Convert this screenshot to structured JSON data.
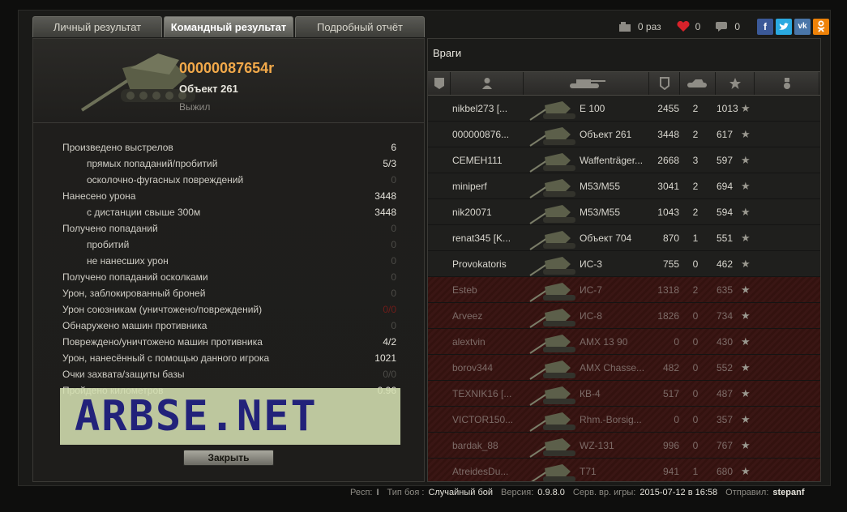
{
  "tabs": [
    {
      "label": "Личный результат"
    },
    {
      "label": "Командный результат"
    },
    {
      "label": "Подробный отчёт"
    }
  ],
  "social": {
    "views_label": "0 раз",
    "likes": "0",
    "comments": "0",
    "networks": [
      "f",
      "t",
      "vk",
      "ok"
    ]
  },
  "player": {
    "name": "00000087654r",
    "vehicle": "Объект 261",
    "status": "Выжил"
  },
  "stats": [
    {
      "label": "Произведено выстрелов",
      "value": "6",
      "indent": false,
      "style": ""
    },
    {
      "label": "прямых попаданий/пробитий",
      "value": "5/3",
      "indent": true,
      "style": ""
    },
    {
      "label": "осколочно-фугасных повреждений",
      "value": "0",
      "indent": true,
      "style": "dim"
    },
    {
      "label": "Нанесено урона",
      "value": "3448",
      "indent": false,
      "style": ""
    },
    {
      "label": "с дистанции свыше 300м",
      "value": "3448",
      "indent": true,
      "style": ""
    },
    {
      "label": "Получено попаданий",
      "value": "0",
      "indent": false,
      "style": "dim"
    },
    {
      "label": "пробитий",
      "value": "0",
      "indent": true,
      "style": "dim"
    },
    {
      "label": "не нанесших урон",
      "value": "0",
      "indent": true,
      "style": "dim"
    },
    {
      "label": "Получено попаданий осколками",
      "value": "0",
      "indent": false,
      "style": "dim"
    },
    {
      "label": "Урон, заблокированный броней",
      "value": "0",
      "indent": false,
      "style": "dim"
    },
    {
      "label": "Урон союзникам (уничтожено/повреждений)",
      "value": "0/0",
      "indent": false,
      "style": "red"
    },
    {
      "label": "Обнаружено машин противника",
      "value": "0",
      "indent": false,
      "style": "dim"
    },
    {
      "label": "Повреждено/уничтожено машин противника",
      "value": "4/2",
      "indent": false,
      "style": ""
    },
    {
      "label": "Урон, нанесённый с помощью данного игрока",
      "value": "1021",
      "indent": false,
      "style": ""
    },
    {
      "label": "Очки захвата/защиты базы",
      "value": "0/0",
      "indent": false,
      "style": "dim"
    },
    {
      "label": "Пройдено километров",
      "value": "0.96",
      "indent": false,
      "style": ""
    }
  ],
  "watermark": "ARBSE.NET",
  "close_label": "Закрыть",
  "enemies": {
    "title": "Враги",
    "rows": [
      {
        "name": "nikbel273 [...",
        "vehicle": "E 100",
        "damage": "2455",
        "kills": "2",
        "xp": "1013",
        "dead": false
      },
      {
        "name": "000000876...",
        "vehicle": "Объект 261",
        "damage": "3448",
        "kills": "2",
        "xp": "617",
        "dead": false
      },
      {
        "name": "CEMEH111",
        "vehicle": "Waffenträger...",
        "damage": "2668",
        "kills": "3",
        "xp": "597",
        "dead": false
      },
      {
        "name": "miniperf",
        "vehicle": "M53/M55",
        "damage": "3041",
        "kills": "2",
        "xp": "694",
        "dead": false
      },
      {
        "name": "nik20071",
        "vehicle": "M53/M55",
        "damage": "1043",
        "kills": "2",
        "xp": "594",
        "dead": false
      },
      {
        "name": "renat345 [K...",
        "vehicle": "Объект 704",
        "damage": "870",
        "kills": "1",
        "xp": "551",
        "dead": false
      },
      {
        "name": "Provokatoris",
        "vehicle": "ИС-3",
        "damage": "755",
        "kills": "0",
        "xp": "462",
        "dead": false
      },
      {
        "name": "Esteb",
        "vehicle": "ИС-7",
        "damage": "1318",
        "kills": "2",
        "xp": "635",
        "dead": true
      },
      {
        "name": "Arveez",
        "vehicle": "ИС-8",
        "damage": "1826",
        "kills": "0",
        "xp": "734",
        "dead": true
      },
      {
        "name": "alextvin",
        "vehicle": "AMX 13 90",
        "damage": "0",
        "kills": "0",
        "xp": "430",
        "dead": true
      },
      {
        "name": "borov344",
        "vehicle": "AMX Chasse...",
        "damage": "482",
        "kills": "0",
        "xp": "552",
        "dead": true
      },
      {
        "name": "TEXNIK16 [...",
        "vehicle": "КВ-4",
        "damage": "517",
        "kills": "0",
        "xp": "487",
        "dead": true
      },
      {
        "name": "VICTOR150...",
        "vehicle": "Rhm.-Borsig...",
        "damage": "0",
        "kills": "0",
        "xp": "357",
        "dead": true
      },
      {
        "name": "bardak_88",
        "vehicle": "WZ-131",
        "damage": "996",
        "kills": "0",
        "xp": "767",
        "dead": true
      },
      {
        "name": "AtreidesDu...",
        "vehicle": "T71",
        "damage": "941",
        "kills": "1",
        "xp": "680",
        "dead": true
      }
    ]
  },
  "footer": {
    "resp_label": "Респ:",
    "resp_value": "I",
    "type_label": "Тип боя :",
    "type_value": "Случайный бой",
    "version_label": "Версия:",
    "version_value": "0.9.8.0",
    "server_label": "Серв. вр. игры:",
    "server_value": "2015-07-12 в 16:58",
    "sender_label": "Отправил:",
    "sender_value": "stepanf"
  },
  "colors": {
    "accent_name": "#f2a94a",
    "dead_row": "#3a1614",
    "like_heart": "#d8222a",
    "facebook": "#3b5998",
    "twitter": "#2aa9e0",
    "vk": "#4a76a8",
    "ok": "#ee8208"
  }
}
